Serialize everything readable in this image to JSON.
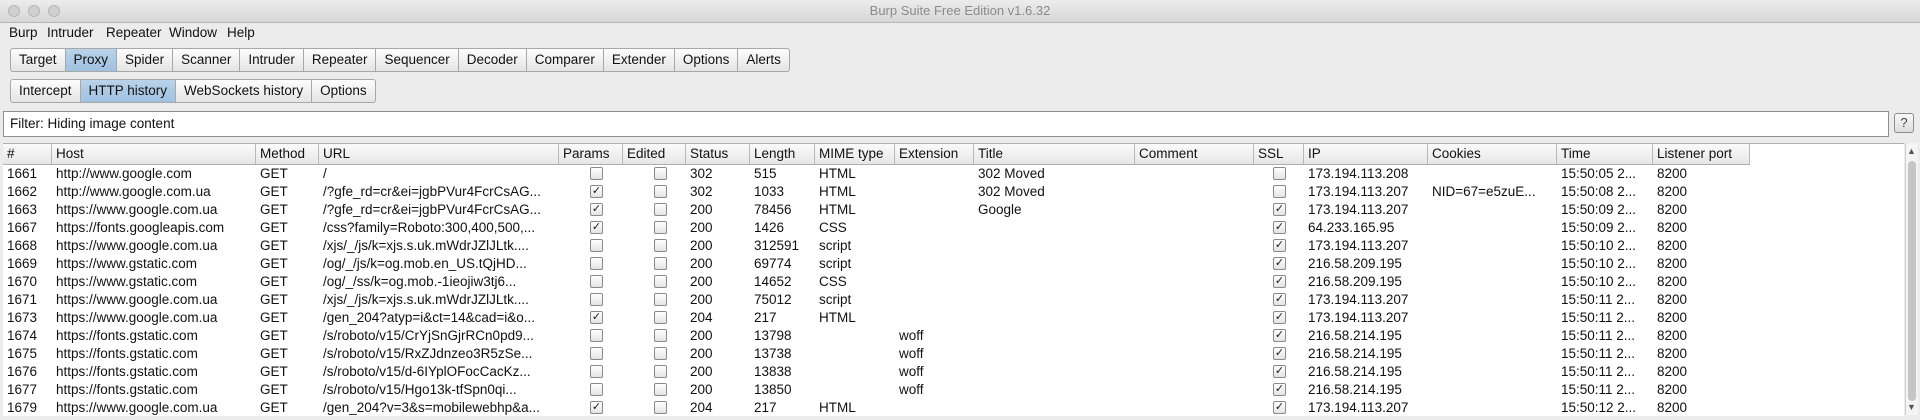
{
  "window": {
    "title": "Burp Suite Free Edition v1.6.32"
  },
  "menubar": {
    "items": [
      "Burp",
      "Intruder",
      "Repeater",
      "Window",
      "Help"
    ]
  },
  "main_tabs": {
    "items": [
      "Target",
      "Proxy",
      "Spider",
      "Scanner",
      "Intruder",
      "Repeater",
      "Sequencer",
      "Decoder",
      "Comparer",
      "Extender",
      "Options",
      "Alerts"
    ],
    "active": "Proxy"
  },
  "sub_tabs": {
    "items": [
      "Intercept",
      "HTTP history",
      "WebSockets history",
      "Options"
    ],
    "active": "HTTP history"
  },
  "filter": {
    "text": "Filter: Hiding image content",
    "help_label": "?"
  },
  "table": {
    "columns": [
      "#",
      "Host",
      "Method",
      "URL",
      "Params",
      "Edited",
      "Status",
      "Length",
      "MIME type",
      "Extension",
      "Title",
      "Comment",
      "SSL",
      "IP",
      "Cookies",
      "Time",
      "Listener port"
    ],
    "sort_indicator": "▲",
    "rows": [
      {
        "id": "1661",
        "host": "http://www.google.com",
        "method": "GET",
        "url": "/",
        "params": false,
        "edited": false,
        "status": "302",
        "length": "515",
        "mime": "HTML",
        "extension": "",
        "title": "302 Moved",
        "comment": "",
        "ssl": false,
        "ip": "173.194.113.208",
        "cookies": "",
        "time": "15:50:05 2...",
        "port": "8200"
      },
      {
        "id": "1662",
        "host": "http://www.google.com.ua",
        "method": "GET",
        "url": "/?gfe_rd=cr&ei=jgbPVur4FcrCsAG...",
        "params": true,
        "edited": false,
        "status": "302",
        "length": "1033",
        "mime": "HTML",
        "extension": "",
        "title": "302 Moved",
        "comment": "",
        "ssl": false,
        "ip": "173.194.113.207",
        "cookies": "NID=67=e5zuE...",
        "time": "15:50:08 2...",
        "port": "8200"
      },
      {
        "id": "1663",
        "host": "https://www.google.com.ua",
        "method": "GET",
        "url": "/?gfe_rd=cr&ei=jgbPVur4FcrCsAG...",
        "params": true,
        "edited": false,
        "status": "200",
        "length": "78456",
        "mime": "HTML",
        "extension": "",
        "title": "Google",
        "comment": "",
        "ssl": true,
        "ip": "173.194.113.207",
        "cookies": "",
        "time": "15:50:09 2...",
        "port": "8200"
      },
      {
        "id": "1667",
        "host": "https://fonts.googleapis.com",
        "method": "GET",
        "url": "/css?family=Roboto:300,400,500,...",
        "params": true,
        "edited": false,
        "status": "200",
        "length": "1426",
        "mime": "CSS",
        "extension": "",
        "title": "",
        "comment": "",
        "ssl": true,
        "ip": "64.233.165.95",
        "cookies": "",
        "time": "15:50:09 2...",
        "port": "8200"
      },
      {
        "id": "1668",
        "host": "https://www.google.com.ua",
        "method": "GET",
        "url": "/xjs/_/js/k=xjs.s.uk.mWdrJZlJLtk....",
        "params": false,
        "edited": false,
        "status": "200",
        "length": "312591",
        "mime": "script",
        "extension": "",
        "title": "",
        "comment": "",
        "ssl": true,
        "ip": "173.194.113.207",
        "cookies": "",
        "time": "15:50:10 2...",
        "port": "8200"
      },
      {
        "id": "1669",
        "host": "https://www.gstatic.com",
        "method": "GET",
        "url": "/og/_/js/k=og.mob.en_US.tQjHD...",
        "params": false,
        "edited": false,
        "status": "200",
        "length": "69774",
        "mime": "script",
        "extension": "",
        "title": "",
        "comment": "",
        "ssl": true,
        "ip": "216.58.209.195",
        "cookies": "",
        "time": "15:50:10 2...",
        "port": "8200"
      },
      {
        "id": "1670",
        "host": "https://www.gstatic.com",
        "method": "GET",
        "url": "/og/_/ss/k=og.mob.-1ieojiw3tj6...",
        "params": false,
        "edited": false,
        "status": "200",
        "length": "14652",
        "mime": "CSS",
        "extension": "",
        "title": "",
        "comment": "",
        "ssl": true,
        "ip": "216.58.209.195",
        "cookies": "",
        "time": "15:50:10 2...",
        "port": "8200"
      },
      {
        "id": "1671",
        "host": "https://www.google.com.ua",
        "method": "GET",
        "url": "/xjs/_/js/k=xjs.s.uk.mWdrJZlJLtk....",
        "params": false,
        "edited": false,
        "status": "200",
        "length": "75012",
        "mime": "script",
        "extension": "",
        "title": "",
        "comment": "",
        "ssl": true,
        "ip": "173.194.113.207",
        "cookies": "",
        "time": "15:50:11 2...",
        "port": "8200"
      },
      {
        "id": "1673",
        "host": "https://www.google.com.ua",
        "method": "GET",
        "url": "/gen_204?atyp=i&ct=14&cad=i&o...",
        "params": true,
        "edited": false,
        "status": "204",
        "length": "217",
        "mime": "HTML",
        "extension": "",
        "title": "",
        "comment": "",
        "ssl": true,
        "ip": "173.194.113.207",
        "cookies": "",
        "time": "15:50:11 2...",
        "port": "8200"
      },
      {
        "id": "1674",
        "host": "https://fonts.gstatic.com",
        "method": "GET",
        "url": "/s/roboto/v15/CrYjSnGjrRCn0pd9...",
        "params": false,
        "edited": false,
        "status": "200",
        "length": "13798",
        "mime": "",
        "extension": "woff",
        "title": "",
        "comment": "",
        "ssl": true,
        "ip": "216.58.214.195",
        "cookies": "",
        "time": "15:50:11 2...",
        "port": "8200"
      },
      {
        "id": "1675",
        "host": "https://fonts.gstatic.com",
        "method": "GET",
        "url": "/s/roboto/v15/RxZJdnzeo3R5zSe...",
        "params": false,
        "edited": false,
        "status": "200",
        "length": "13738",
        "mime": "",
        "extension": "woff",
        "title": "",
        "comment": "",
        "ssl": true,
        "ip": "216.58.214.195",
        "cookies": "",
        "time": "15:50:11 2...",
        "port": "8200"
      },
      {
        "id": "1676",
        "host": "https://fonts.gstatic.com",
        "method": "GET",
        "url": "/s/roboto/v15/d-6IYplOFocCacKz...",
        "params": false,
        "edited": false,
        "status": "200",
        "length": "13838",
        "mime": "",
        "extension": "woff",
        "title": "",
        "comment": "",
        "ssl": true,
        "ip": "216.58.214.195",
        "cookies": "",
        "time": "15:50:11 2...",
        "port": "8200"
      },
      {
        "id": "1677",
        "host": "https://fonts.gstatic.com",
        "method": "GET",
        "url": "/s/roboto/v15/Hgo13k-tfSpn0qi...",
        "params": false,
        "edited": false,
        "status": "200",
        "length": "13850",
        "mime": "",
        "extension": "woff",
        "title": "",
        "comment": "",
        "ssl": true,
        "ip": "216.58.214.195",
        "cookies": "",
        "time": "15:50:11 2...",
        "port": "8200"
      },
      {
        "id": "1679",
        "host": "https://www.google.com.ua",
        "method": "GET",
        "url": "/gen_204?v=3&s=mobilewebhp&a...",
        "params": true,
        "edited": false,
        "status": "204",
        "length": "217",
        "mime": "HTML",
        "extension": "",
        "title": "",
        "comment": "",
        "ssl": true,
        "ip": "173.194.113.207",
        "cookies": "",
        "time": "15:50:12 2...",
        "port": "8200"
      }
    ]
  },
  "colors": {
    "tab_active": "#a9c9e6",
    "window_bg": "#ececec"
  }
}
